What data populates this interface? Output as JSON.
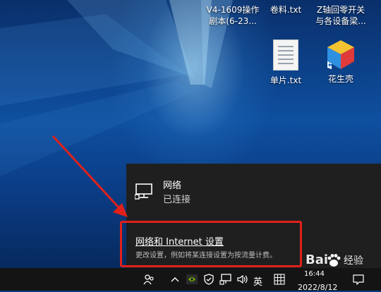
{
  "desktop": {
    "icons": [
      {
        "name": "desktop-file-v4",
        "label_line1": "V4-1609操作",
        "label_line2": "剧本(6-23..."
      },
      {
        "name": "desktop-file-juanliao",
        "label_line1": "卷料.txt",
        "label_line2": ""
      },
      {
        "name": "desktop-file-zaxis",
        "label_line1": "Z轴回零开关",
        "label_line2": "与各设备梁..."
      },
      {
        "name": "desktop-file-danpian",
        "label_line1": "单片.txt",
        "label_line2": ""
      },
      {
        "name": "desktop-app-huashengke",
        "label_line1": "花生壳",
        "label_line2": ""
      }
    ]
  },
  "network_flyout": {
    "network_name": "网络",
    "network_status": "已连接",
    "settings_link": "网络和 Internet 设置",
    "settings_desc": "更改设置，例如将某连接设置为按流量计费。"
  },
  "taskbar": {
    "ime_label": "英",
    "time": "16:44",
    "date": "2022/8/12"
  },
  "watermark": {
    "text": "Bai",
    "suffix": "经验"
  },
  "colors": {
    "flyout_bg": "#1f1f1f",
    "taskbar_bg": "#141414",
    "highlight": "#e0211b",
    "accent": "#0e4f9f"
  }
}
